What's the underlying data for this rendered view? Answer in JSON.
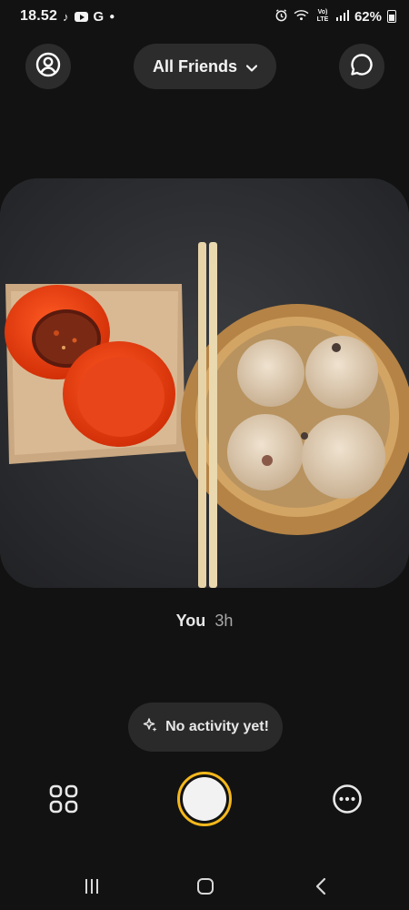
{
  "status_bar": {
    "time": "18.52",
    "battery_percent": "62%",
    "network_label": "Vo) LTE",
    "left_icons": [
      "tiktok-icon",
      "youtube-icon",
      "g-icon"
    ],
    "right_icons": [
      "alarm-icon",
      "wifi-icon",
      "signal-icon",
      "battery-icon"
    ]
  },
  "header": {
    "filter_label": "All Friends",
    "filter_icon": "chevron-down-icon",
    "left_icon": "profile-icon",
    "right_icon": "chat-icon"
  },
  "post": {
    "author": "You",
    "time_ago": "3h"
  },
  "activity": {
    "label": "No activity yet!",
    "icon": "sparkle-icon"
  },
  "controls": {
    "left_icon": "grid-icon",
    "center": "shutter-button",
    "shutter_ring_color": "#f5b81c",
    "right_icon": "more-icon"
  },
  "nav_bar": {
    "buttons": [
      "recents-icon",
      "home-icon",
      "back-icon"
    ]
  }
}
